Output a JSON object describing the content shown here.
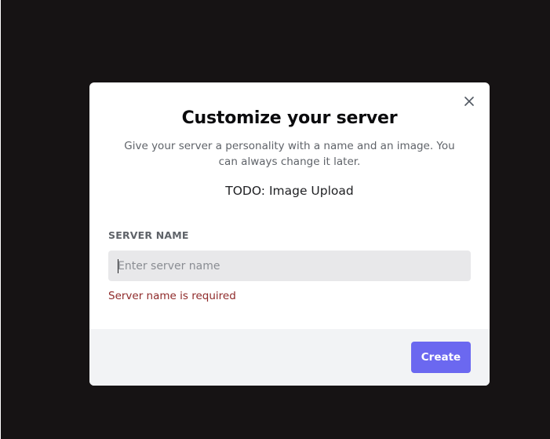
{
  "modal": {
    "title": "Customize your server",
    "subtitle": "Give your server a personality with a name and an image. You can always change it later.",
    "image_upload_text": "TODO: Image Upload",
    "close_icon": "close-icon"
  },
  "form": {
    "server_name_label": "SERVER NAME",
    "server_name_placeholder": "Enter server name",
    "server_name_value": "",
    "error_text": "Server name is required"
  },
  "footer": {
    "create_label": "Create"
  },
  "colors": {
    "backdrop": "#161314",
    "accent": "#6b68f0",
    "error": "#8f2a2a",
    "footer_bg": "#f2f3f5"
  }
}
